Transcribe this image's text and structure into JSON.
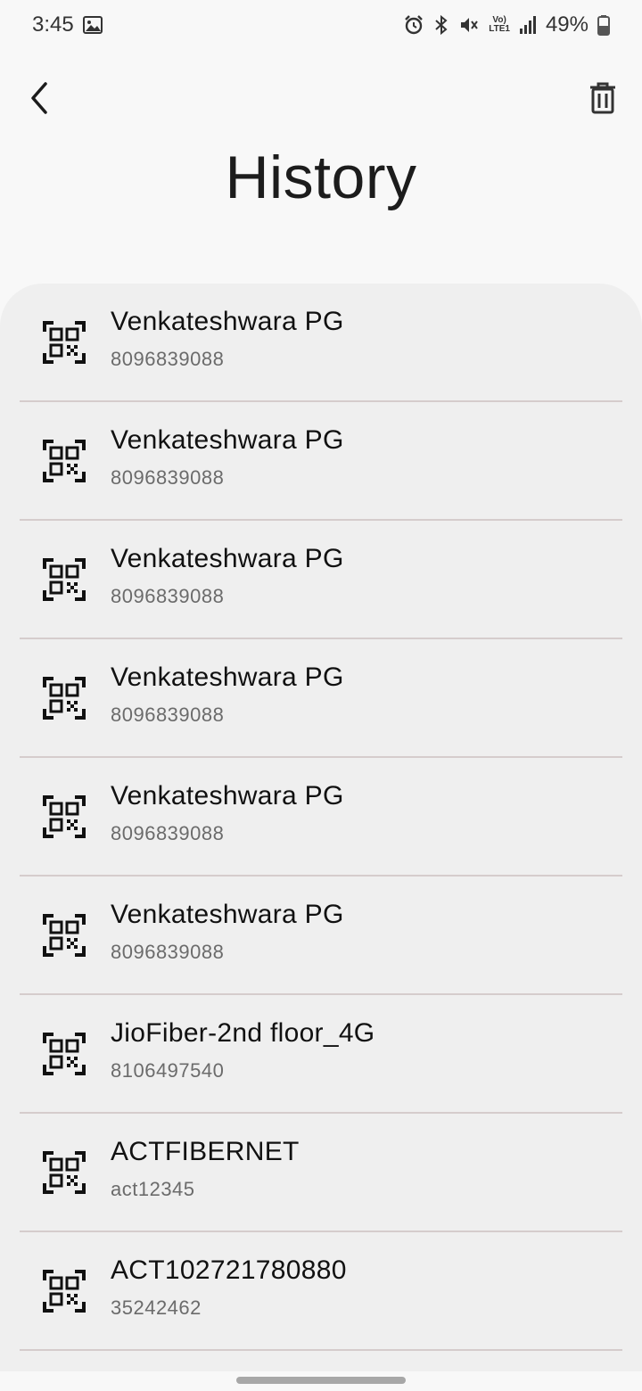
{
  "status_bar": {
    "time": "3:45",
    "lte_label": "LTE1",
    "volte_label": "Vo)",
    "battery": "49%"
  },
  "toolbar": {
    "back_icon": "back-arrow-icon",
    "delete_icon": "trash-icon"
  },
  "page": {
    "title": "History"
  },
  "history": [
    {
      "title": "Venkateshwara PG",
      "subtitle": "8096839088",
      "icon": "qr-code-icon"
    },
    {
      "title": "Venkateshwara PG",
      "subtitle": "8096839088",
      "icon": "qr-code-icon"
    },
    {
      "title": "Venkateshwara PG",
      "subtitle": "8096839088",
      "icon": "qr-code-icon"
    },
    {
      "title": "Venkateshwara PG",
      "subtitle": "8096839088",
      "icon": "qr-code-icon"
    },
    {
      "title": "Venkateshwara PG",
      "subtitle": "8096839088",
      "icon": "qr-code-icon"
    },
    {
      "title": "Venkateshwara PG",
      "subtitle": "8096839088",
      "icon": "qr-code-icon"
    },
    {
      "title": "JioFiber-2nd floor_4G",
      "subtitle": "8106497540",
      "icon": "qr-code-icon"
    },
    {
      "title": "ACTFIBERNET",
      "subtitle": "act12345",
      "icon": "qr-code-icon"
    },
    {
      "title": "ACT102721780880",
      "subtitle": "35242462",
      "icon": "qr-code-icon"
    }
  ],
  "colors": {
    "background": "#f8f8f8",
    "card": "#efefef",
    "divider": "#d5cccc"
  }
}
